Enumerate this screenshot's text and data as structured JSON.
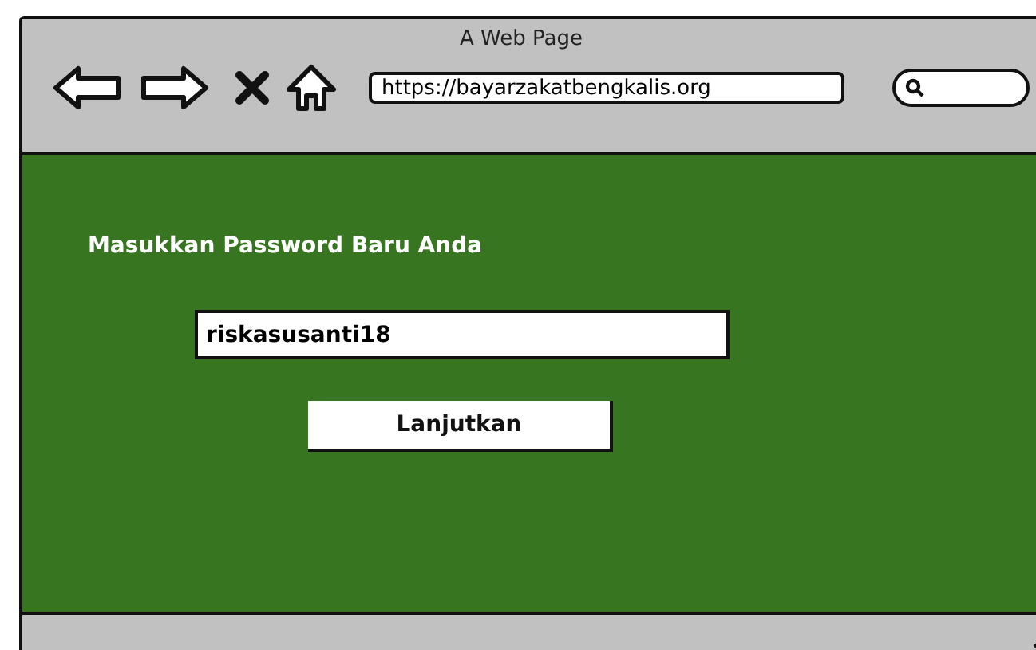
{
  "window": {
    "title": "A Web Page"
  },
  "address_bar": {
    "value": "https://bayarzakatbengkalis.org"
  },
  "page": {
    "heading": "Masukkan Password Baru Anda",
    "password_field": {
      "value": "riskasusanti18"
    },
    "button": {
      "label": "Lanjutkan"
    }
  }
}
